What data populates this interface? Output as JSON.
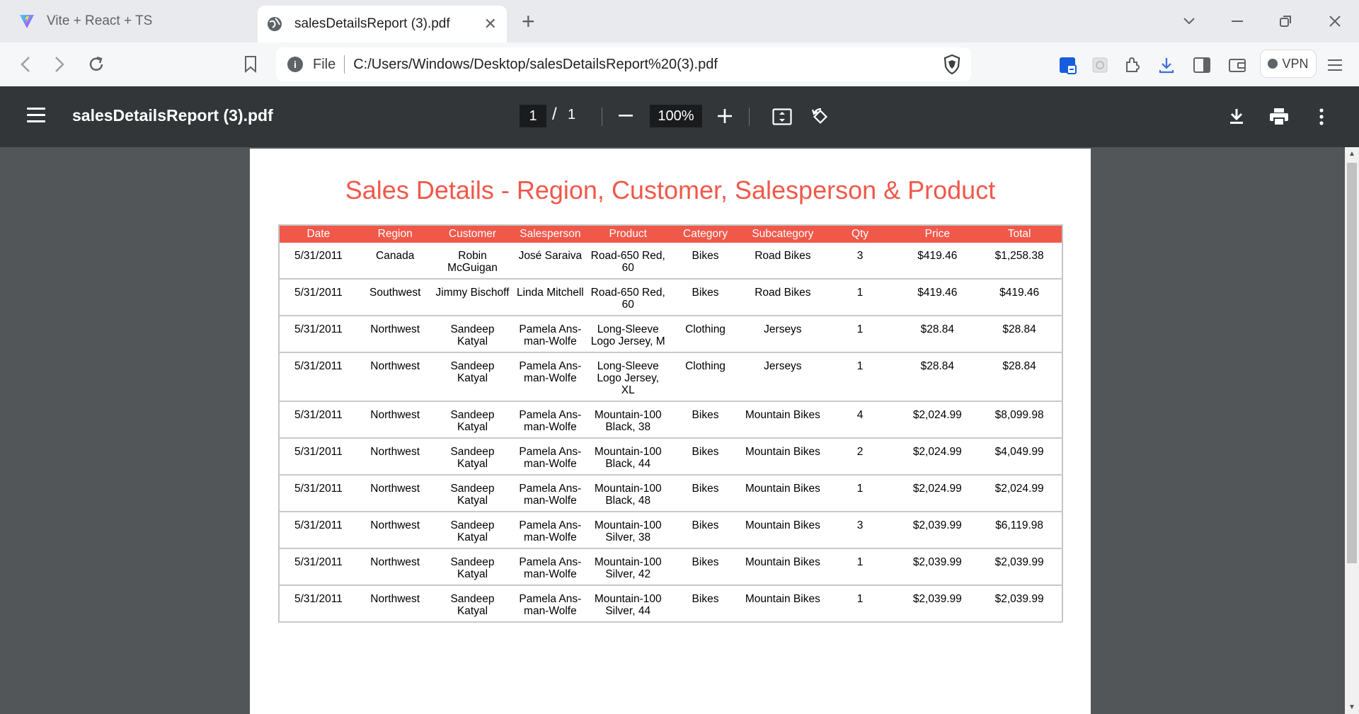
{
  "browser": {
    "tabs": [
      {
        "title": "Vite + React + TS",
        "active": false,
        "icon": "vite-logo-icon"
      },
      {
        "title": "salesDetailsReport (3).pdf",
        "active": true,
        "icon": "globe-icon"
      }
    ],
    "address": {
      "scheme": "File",
      "url": "C:/Users/Windows/Desktop/salesDetailsReport%20(3).pdf"
    },
    "vpn_label": "VPN"
  },
  "viewer": {
    "title": "salesDetailsReport (3).pdf",
    "current_page": "1",
    "page_separator": "/",
    "total_pages": "1",
    "zoom": "100%"
  },
  "report": {
    "title": "Sales Details - Region, Customer, Salesperson & Product",
    "header_color": "#f0584a",
    "columns": [
      "Date",
      "Region",
      "Customer",
      "Salesperson",
      "Product",
      "Category",
      "Subcategory",
      "Qty",
      "Price",
      "Total"
    ],
    "rows": [
      [
        "5/31/2011",
        "Canada",
        "Robin McGuigan",
        "José Saraiva",
        "Road-650 Red, 60",
        "Bikes",
        "Road Bikes",
        "3",
        "$419.46",
        "$1,258.38"
      ],
      [
        "5/31/2011",
        "Southwest",
        "Jimmy Bischoff",
        "Linda Mitchell",
        "Road-650 Red, 60",
        "Bikes",
        "Road Bikes",
        "1",
        "$419.46",
        "$419.46"
      ],
      [
        "5/31/2011",
        "Northwest",
        "Sandeep Katyal",
        "Pamela Ans-man-Wolfe",
        "Long-Sleeve Logo Jersey, M",
        "Clothing",
        "Jerseys",
        "1",
        "$28.84",
        "$28.84"
      ],
      [
        "5/31/2011",
        "Northwest",
        "Sandeep Katyal",
        "Pamela Ans-man-Wolfe",
        "Long-Sleeve Logo Jersey, XL",
        "Clothing",
        "Jerseys",
        "1",
        "$28.84",
        "$28.84"
      ],
      [
        "5/31/2011",
        "Northwest",
        "Sandeep Katyal",
        "Pamela Ans-man-Wolfe",
        "Mountain-100 Black, 38",
        "Bikes",
        "Mountain Bikes",
        "4",
        "$2,024.99",
        "$8,099.98"
      ],
      [
        "5/31/2011",
        "Northwest",
        "Sandeep Katyal",
        "Pamela Ans-man-Wolfe",
        "Mountain-100 Black, 44",
        "Bikes",
        "Mountain Bikes",
        "2",
        "$2,024.99",
        "$4,049.99"
      ],
      [
        "5/31/2011",
        "Northwest",
        "Sandeep Katyal",
        "Pamela Ans-man-Wolfe",
        "Mountain-100 Black, 48",
        "Bikes",
        "Mountain Bikes",
        "1",
        "$2,024.99",
        "$2,024.99"
      ],
      [
        "5/31/2011",
        "Northwest",
        "Sandeep Katyal",
        "Pamela Ans-man-Wolfe",
        "Mountain-100 Silver, 38",
        "Bikes",
        "Mountain Bikes",
        "3",
        "$2,039.99",
        "$6,119.98"
      ],
      [
        "5/31/2011",
        "Northwest",
        "Sandeep Katyal",
        "Pamela Ans-man-Wolfe",
        "Mountain-100 Silver, 42",
        "Bikes",
        "Mountain Bikes",
        "1",
        "$2,039.99",
        "$2,039.99"
      ],
      [
        "5/31/2011",
        "Northwest",
        "Sandeep Katyal",
        "Pamela Ans-man-Wolfe",
        "Mountain-100 Silver, 44",
        "Bikes",
        "Mountain Bikes",
        "1",
        "$2,039.99",
        "$2,039.99"
      ]
    ]
  }
}
